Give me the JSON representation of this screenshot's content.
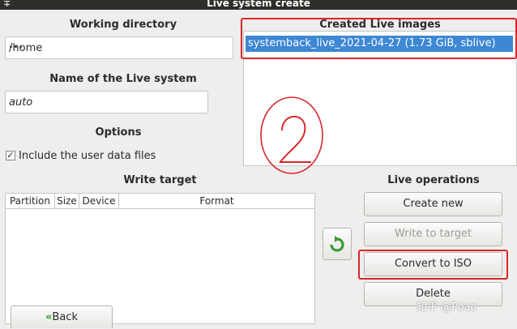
{
  "window": {
    "title": "Live system create",
    "pin_icon": "pin-icon"
  },
  "working_directory": {
    "label": "Working directory",
    "value": "/home",
    "browse_label": "..."
  },
  "live_name": {
    "label": "Name of the Live system",
    "value": "auto"
  },
  "options": {
    "label": "Options",
    "include_user_data": {
      "label": "Include the user data files",
      "checked": true,
      "check_mark": "✓"
    }
  },
  "write_target": {
    "label": "Write target",
    "columns": [
      "Partition",
      "Size",
      "Device",
      "Format"
    ]
  },
  "created_images": {
    "label": "Created Live images",
    "items": [
      "systemback_live_2021-04-27 (1.73 GiB, sblive)"
    ]
  },
  "live_operations": {
    "label": "Live operations",
    "create_new": "Create new",
    "write_to_target": "Write to target",
    "convert_to_iso": "Convert to ISO",
    "delete": "Delete"
  },
  "back_button": {
    "label": "Back",
    "icon": "chevron-double-left-icon"
  },
  "watermark": {
    "brand": "知乎 @Poao"
  },
  "colors": {
    "selection": "#3d87d5",
    "annotation_red": "#d8262b",
    "refresh_green": "#3a9a3a"
  }
}
